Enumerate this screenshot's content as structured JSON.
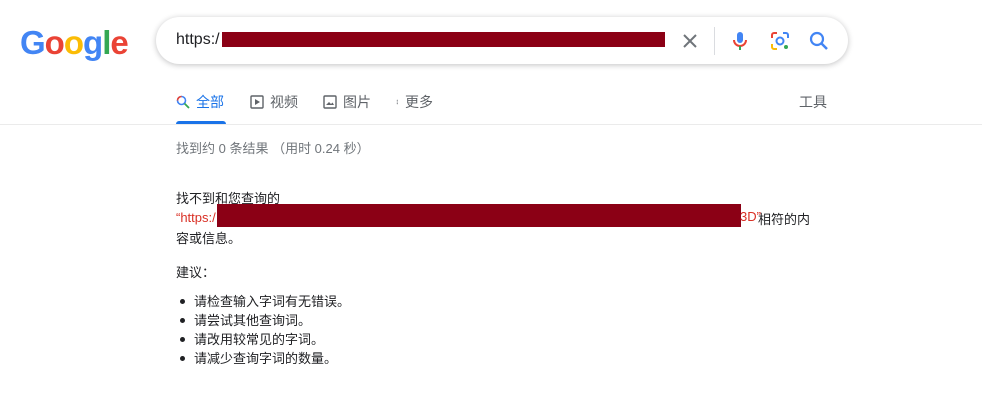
{
  "logo": {
    "letters": [
      "G",
      "o",
      "o",
      "g",
      "l",
      "e"
    ]
  },
  "search": {
    "query": "https:/",
    "clear_icon": "close-icon",
    "mic_icon": "mic-icon",
    "lens_icon": "lens-icon",
    "search_icon": "search-icon"
  },
  "tabs": [
    {
      "label": "全部",
      "icon": "search-icon",
      "active": true
    },
    {
      "label": "视频",
      "icon": "play-icon",
      "active": false
    },
    {
      "label": "图片",
      "icon": "image-icon",
      "active": false
    },
    {
      "label": "更多",
      "icon": "more-vert-icon",
      "active": false
    }
  ],
  "tools_label": "工具",
  "stats": "找到约 0 条结果 （用时 0.24 秒）",
  "noresult": {
    "prefix": "找不到和您查询的",
    "open_quote": "“https:/",
    "close_quote": "3D”",
    "suffix": "相符的内",
    "line3": "容或信息。"
  },
  "suggestions_title": "建议：",
  "suggestions": [
    "请检查输入字词有无错误。",
    "请尝试其他查询词。",
    "请改用较常见的字词。",
    "请减少查询字词的数量。"
  ],
  "colors": {
    "accent": "#1a73e8",
    "redaction": "#8b0015",
    "query_red": "#d93025"
  }
}
